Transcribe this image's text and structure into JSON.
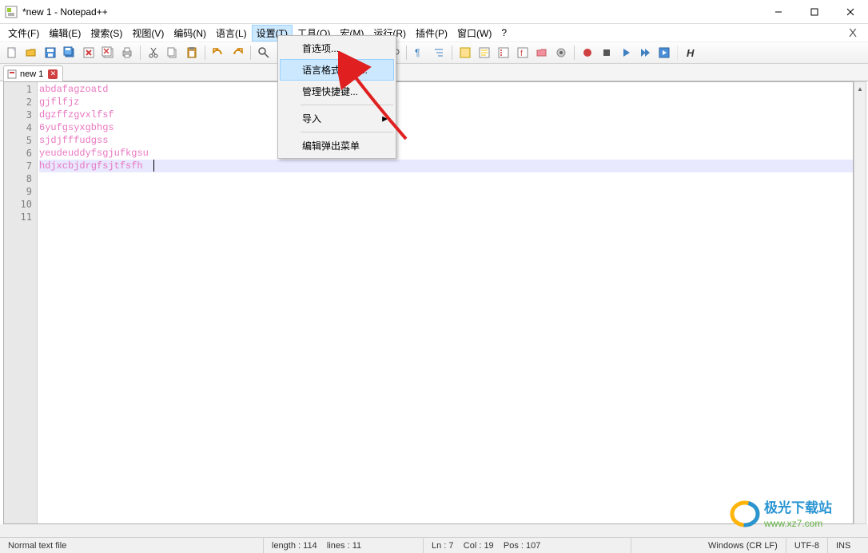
{
  "window": {
    "title": "*new 1 - Notepad++"
  },
  "menubar": {
    "items": [
      {
        "label": "文件(F)"
      },
      {
        "label": "编辑(E)"
      },
      {
        "label": "搜索(S)"
      },
      {
        "label": "视图(V)"
      },
      {
        "label": "编码(N)"
      },
      {
        "label": "语言(L)"
      },
      {
        "label": "设置(T)",
        "active": true
      },
      {
        "label": "工具(O)"
      },
      {
        "label": "宏(M)"
      },
      {
        "label": "运行(R)"
      },
      {
        "label": "插件(P)"
      },
      {
        "label": "窗口(W)"
      },
      {
        "label": "?"
      }
    ],
    "right_x": "X"
  },
  "dropdown": {
    "items": [
      {
        "label": "首选项..."
      },
      {
        "label": "语言格式设置...",
        "highlight": true
      },
      {
        "label": "管理快捷键..."
      },
      {
        "sep": true
      },
      {
        "label": "导入",
        "submenu": true
      },
      {
        "sep": true
      },
      {
        "label": "编辑弹出菜单"
      }
    ]
  },
  "tabs": [
    {
      "label": "new 1"
    }
  ],
  "editor": {
    "lines": [
      "abdafagzoatd",
      "gjflfjz",
      "dgzffzgvxlfsf",
      "6yufgsyxgbhgs",
      "sjdjfffudgss",
      "yeudeuddyfsgjufkgsu",
      "hdjxcbjdrgfsjtfsfh"
    ],
    "line_numbers": [
      "1",
      "2",
      "3",
      "4",
      "5",
      "6",
      "7",
      "8",
      "9",
      "10",
      "11"
    ],
    "current_line_index": 6
  },
  "statusbar": {
    "filetype": "Normal text file",
    "length": "length : 114",
    "lines": "lines : 11",
    "ln": "Ln : 7",
    "col": "Col : 19",
    "pos": "Pos : 107",
    "eol": "Windows (CR LF)",
    "encoding": "UTF-8",
    "insmode": "INS"
  },
  "watermark": {
    "brand": "极光下载站",
    "url": "www.xz7.com"
  }
}
